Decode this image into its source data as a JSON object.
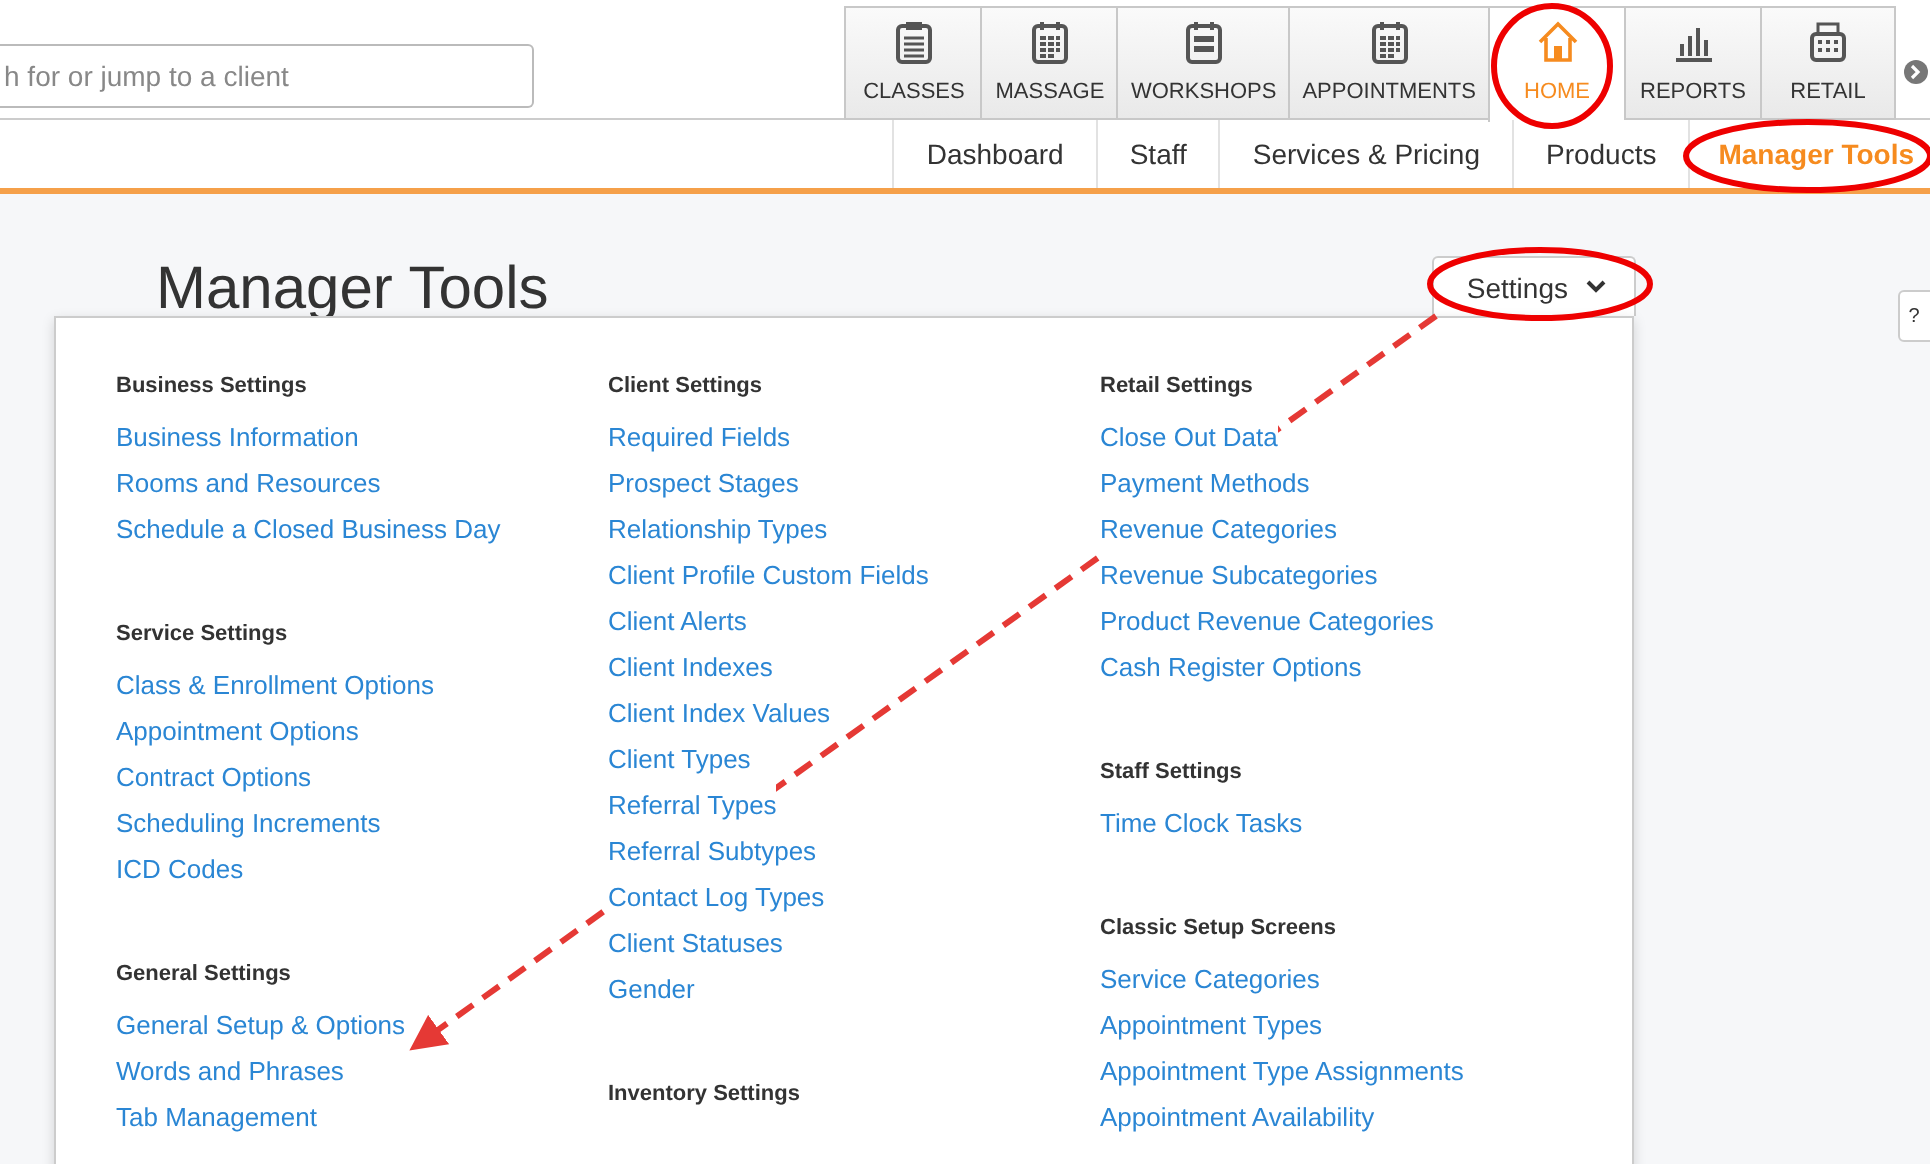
{
  "search": {
    "placeholder": "h for or jump to a client"
  },
  "nav_tabs": [
    {
      "label": "CLASSES",
      "selected": false
    },
    {
      "label": "MASSAGE",
      "selected": false
    },
    {
      "label": "WORKSHOPS",
      "selected": false
    },
    {
      "label": "APPOINTMENTS",
      "selected": false
    },
    {
      "label": "HOME",
      "selected": true
    },
    {
      "label": "REPORTS",
      "selected": false
    },
    {
      "label": "RETAIL",
      "selected": false
    }
  ],
  "sub_nav": [
    {
      "label": "Dashboard",
      "selected": false
    },
    {
      "label": "Staff",
      "selected": false
    },
    {
      "label": "Services & Pricing",
      "selected": false
    },
    {
      "label": "Products",
      "selected": false
    },
    {
      "label": "Manager Tools",
      "selected": true
    }
  ],
  "page_title": "Manager Tools",
  "settings_button": "Settings",
  "help_tab": "?",
  "menu": {
    "columns": [
      {
        "sections": [
          {
            "heading": "Business Settings",
            "links": [
              "Business Information",
              "Rooms and Resources",
              "Schedule a Closed Business Day"
            ]
          },
          {
            "heading": "Service Settings",
            "links": [
              "Class & Enrollment Options",
              "Appointment Options",
              "Contract Options",
              "Scheduling Increments",
              "ICD Codes"
            ]
          },
          {
            "heading": "General Settings",
            "links": [
              "General Setup & Options",
              "Words and Phrases",
              "Tab Management"
            ]
          }
        ]
      },
      {
        "sections": [
          {
            "heading": "Client Settings",
            "links": [
              "Required Fields",
              "Prospect Stages",
              "Relationship Types",
              "Client Profile Custom Fields",
              "Client Alerts",
              "Client Indexes",
              "Client Index Values",
              "Client Types",
              "Referral Types",
              "Referral Subtypes",
              "Contact Log Types",
              "Client Statuses",
              "Gender"
            ]
          },
          {
            "heading": "Inventory Settings"
          }
        ]
      },
      {
        "sections": [
          {
            "heading": "Retail Settings",
            "links": [
              "Close Out Data",
              "Payment Methods",
              "Revenue Categories",
              "Revenue Subcategories",
              "Product Revenue Categories",
              "Cash Register Options"
            ]
          },
          {
            "heading": "Staff Settings",
            "links": [
              "Time Clock Tasks"
            ]
          },
          {
            "heading": "Classic Setup Screens",
            "links": [
              "Service Categories",
              "Appointment Types",
              "Appointment Type Assignments",
              "Appointment Availability"
            ]
          }
        ]
      }
    ]
  }
}
